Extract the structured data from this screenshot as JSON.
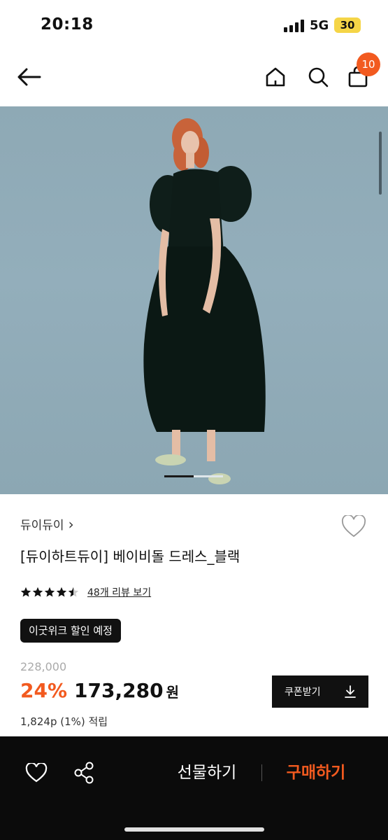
{
  "status_bar": {
    "time": "20:18",
    "network": "5G",
    "battery": "30",
    "icons": [
      "signal-bars-icon",
      "battery-icon"
    ]
  },
  "nav": {
    "icons": [
      "back-arrow-icon",
      "home-icon",
      "search-icon",
      "shopping-bag-icon"
    ],
    "cart_count": "10"
  },
  "product": {
    "brand": "듀이듀이",
    "brand_chevron": "›",
    "title": "[듀이하트듀이] 베이비돌 드레스_블랙",
    "rating": 4.5,
    "review_link": "48개 리뷰 보기",
    "promo_badge": "이굿위크 할인 예정",
    "original_price": "228,000",
    "discount": "24%",
    "sale_price": "173,280",
    "currency": "원",
    "points": "1,824p (1%) 적립",
    "coupon_label": "쿠폰받기",
    "image_index": 1,
    "image_count": 2
  },
  "bottom_bar": {
    "gift_label": "선물하기",
    "buy_label": "구매하기",
    "icons": [
      "heart-icon",
      "share-icon"
    ]
  },
  "colors": {
    "accent": "#f25a1f",
    "dark": "#111111",
    "hero_bg": "#8ea9b5"
  }
}
